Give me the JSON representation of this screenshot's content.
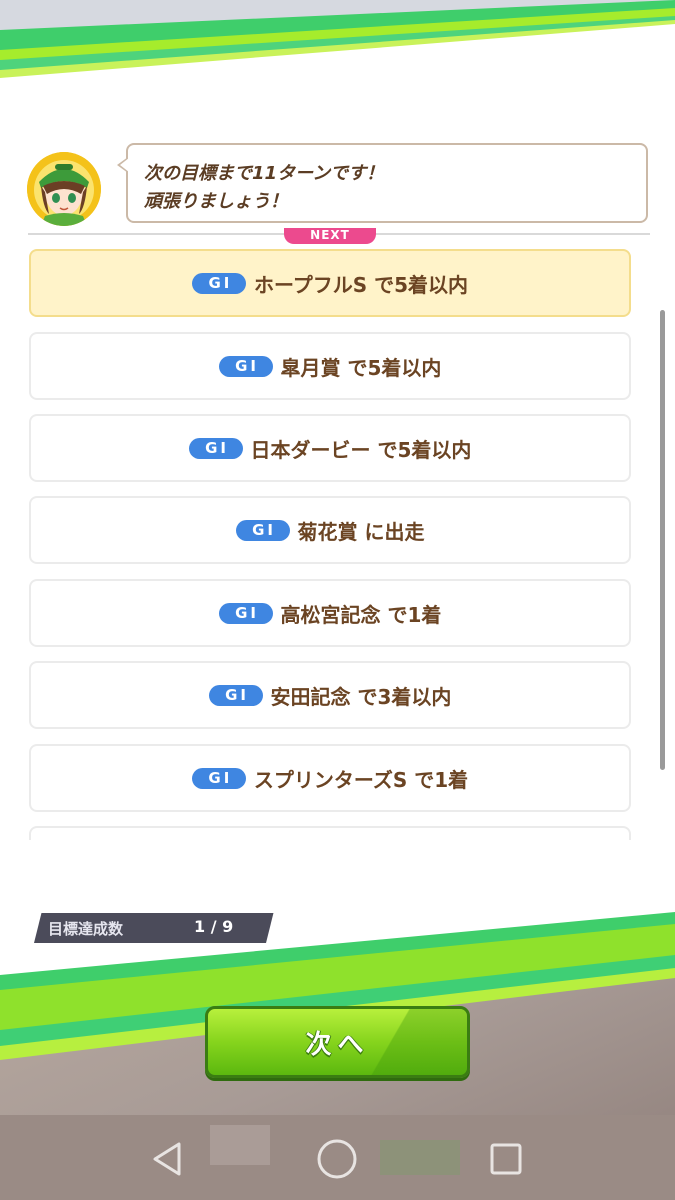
{
  "speech": {
    "line1": "次の目標まで11ターンです！",
    "line2": "頑張りましょう！"
  },
  "next_tag": "NEXT",
  "goals": [
    {
      "grade": "GI",
      "text": "ホープフルS で5着以内",
      "active": true
    },
    {
      "grade": "GI",
      "text": "皐月賞 で5着以内",
      "active": false
    },
    {
      "grade": "GI",
      "text": "日本ダービー で5着以内",
      "active": false
    },
    {
      "grade": "GI",
      "text": "菊花賞 に出走",
      "active": false
    },
    {
      "grade": "GI",
      "text": "高松宮記念 で1着",
      "active": false
    },
    {
      "grade": "GI",
      "text": "安田記念 で3着以内",
      "active": false
    },
    {
      "grade": "GI",
      "text": "スプリンターズS で1着",
      "active": false
    }
  ],
  "progress": {
    "label": "目標達成数",
    "value": "1 / 9"
  },
  "next_button": {
    "label": "次へ"
  },
  "nav_bar": {
    "back_icon": "back-triangle-icon",
    "home_icon": "home-circle-icon",
    "recents_icon": "recents-square-icon"
  },
  "colors": {
    "accent_green": "#6fd12a",
    "grade_blue": "#3f86e1",
    "text_brown": "#6b4423",
    "active_row": "#fff3c9",
    "next_tag_pink": "#ec4a8e"
  }
}
